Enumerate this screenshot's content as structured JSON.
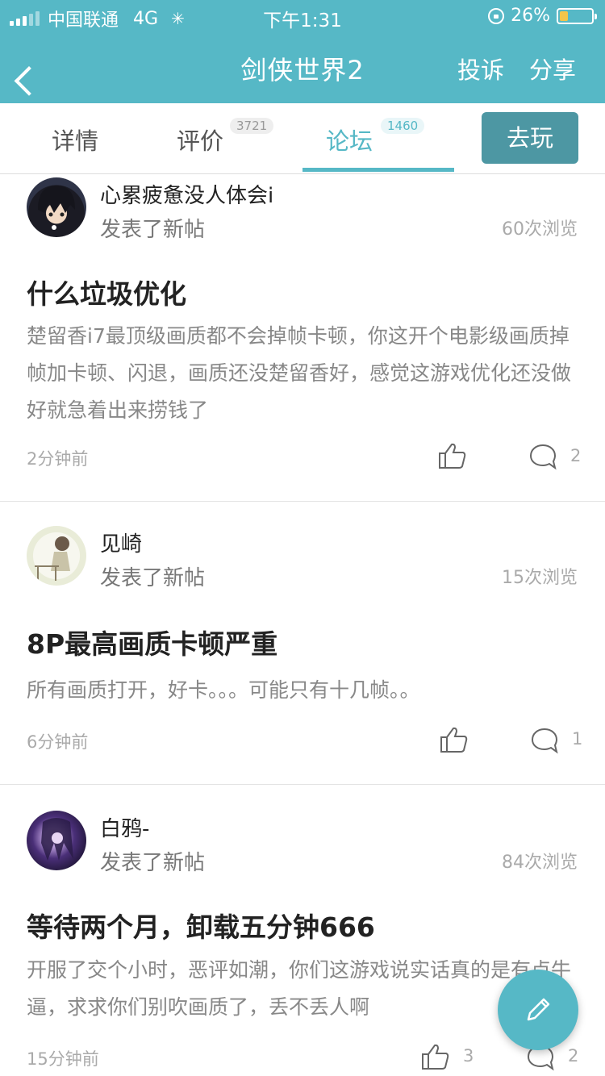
{
  "status": {
    "carrier": "中国联通",
    "network": "4G",
    "time": "下午1:31",
    "battery_text": "26%",
    "battery_level": 0.26
  },
  "nav": {
    "title": "剑侠世界2",
    "report": "投诉",
    "share": "分享"
  },
  "tabs": {
    "details": "详情",
    "reviews": "评价",
    "reviews_count": "3721",
    "forum": "论坛",
    "forum_count": "1460",
    "play": "去玩"
  },
  "posts": [
    {
      "username": "心累疲惫没人体会i",
      "action": "发表了新帖",
      "views": "60次浏览",
      "title": "什么垃圾优化",
      "body": "楚留香i7最顶级画质都不会掉帧卡顿，你这开个电影级画质掉帧加卡顿、闪退，画质还没楚留香好，感觉这游戏优化还没做好就急着出来捞钱了",
      "time": "2分钟前",
      "likes": "",
      "comments": "2"
    },
    {
      "username": "见崎",
      "action": "发表了新帖",
      "views": "15次浏览",
      "title": "8P最高画质卡顿严重",
      "body": "所有画质打开，好卡。。。可能只有十几帧。。",
      "time": "6分钟前",
      "likes": "",
      "comments": "1"
    },
    {
      "username": "白鸦-",
      "action": "发表了新帖",
      "views": "84次浏览",
      "title": "等待两个月，卸载五分钟666",
      "body": "开服了交个小时，恶评如潮，你们这游戏说实话真的是有点牛逼，求求你们别吹画质了，丢不丢人啊",
      "time": "15分钟前",
      "likes": "3",
      "comments": "2"
    }
  ]
}
